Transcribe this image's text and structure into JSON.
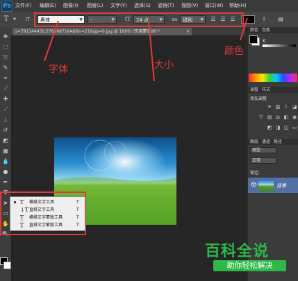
{
  "app": {
    "logo": "Ps"
  },
  "menu": {
    "items": [
      "文件(F)",
      "编辑(E)",
      "图像(I)",
      "图层(L)",
      "文字(Y)",
      "选择(S)",
      "滤镜(T)",
      "视图(V)",
      "窗口(W)",
      "帮助(H)"
    ]
  },
  "options_bar": {
    "tool_glyph": "T",
    "orientation_glyph": "IT",
    "font_family": "黑体",
    "font_style": "-",
    "size_glyph": "tT",
    "font_size": "24 点",
    "aa_label": "aa",
    "antialias": "锐利",
    "color_swatch": "#000000"
  },
  "document_tab": {
    "title": "u=791144430,2785687164&fm=21&gp=0.jpg @ 100% (快速蒙版/8) *",
    "close": "×"
  },
  "annotations": {
    "font_label": "字体",
    "size_label": "大小",
    "color_label": "颜色"
  },
  "type_flyout": {
    "items": [
      {
        "label": "横排文字工具",
        "shortcut": "T",
        "active": true
      },
      {
        "label": "直排文字工具",
        "shortcut": "T",
        "active": false
      },
      {
        "label": "横排文字蒙版工具",
        "shortcut": "T",
        "active": false
      },
      {
        "label": "直排文字蒙版工具",
        "shortcut": "T",
        "active": false
      }
    ]
  },
  "right_panel": {
    "color_tabs": [
      "颜色",
      "色板"
    ],
    "k_label": "K",
    "adjust_tabs": [
      "调整",
      "样式"
    ],
    "adjust_title": "添加调整",
    "layer_tabs": [
      "图层",
      "通道",
      "路径"
    ],
    "kind_select": "类型",
    "blend_mode": "正常",
    "lock_label": "锁定:",
    "layer_name": "背景"
  },
  "watermark": {
    "title": "百科全说",
    "subtitle": "助你轻松解决"
  }
}
